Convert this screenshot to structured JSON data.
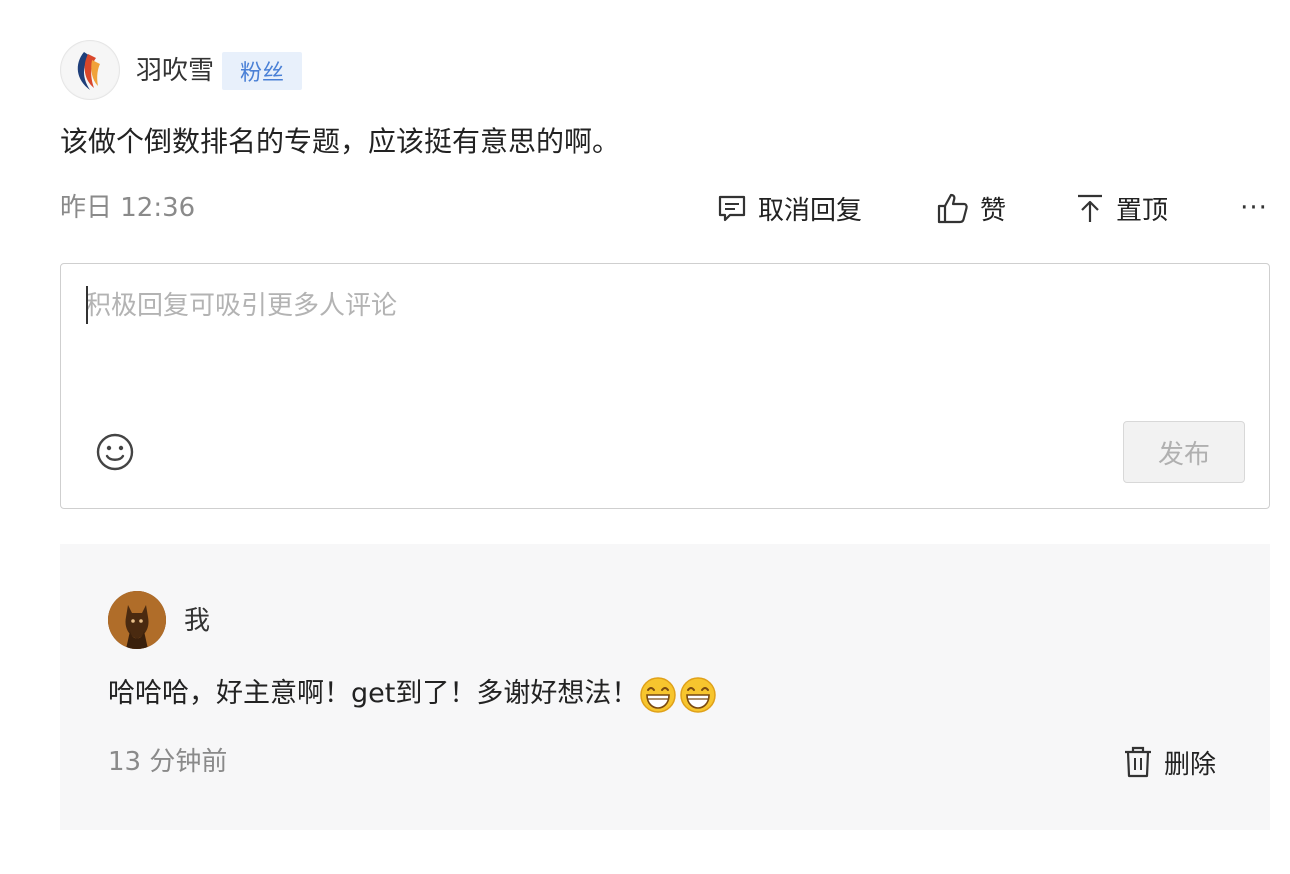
{
  "comment": {
    "username": "羽吹雪",
    "badge": "粉丝",
    "text": "该做个倒数排名的专题，应该挺有意思的啊。",
    "time": "昨日 12:36",
    "actions": {
      "reply": "取消回复",
      "like": "赞",
      "pin": "置顶",
      "more": "···"
    }
  },
  "reply_box": {
    "placeholder": "积极回复可吸引更多人评论",
    "value": "",
    "emoji_icon": "smiley-icon",
    "publish": "发布"
  },
  "sub_reply": {
    "username": "我",
    "text": "哈哈哈，好主意啊！get到了！多谢好想法！",
    "emojis": [
      "grin-emoji",
      "grin-emoji"
    ],
    "time": "13 分钟前",
    "delete": "删除"
  },
  "colors": {
    "badge_bg": "#e8f0fb",
    "badge_text": "#4a80d6",
    "muted_text": "#8a8a8a",
    "panel_bg": "#f7f7f8",
    "publish_disabled_bg": "#f2f2f2"
  }
}
